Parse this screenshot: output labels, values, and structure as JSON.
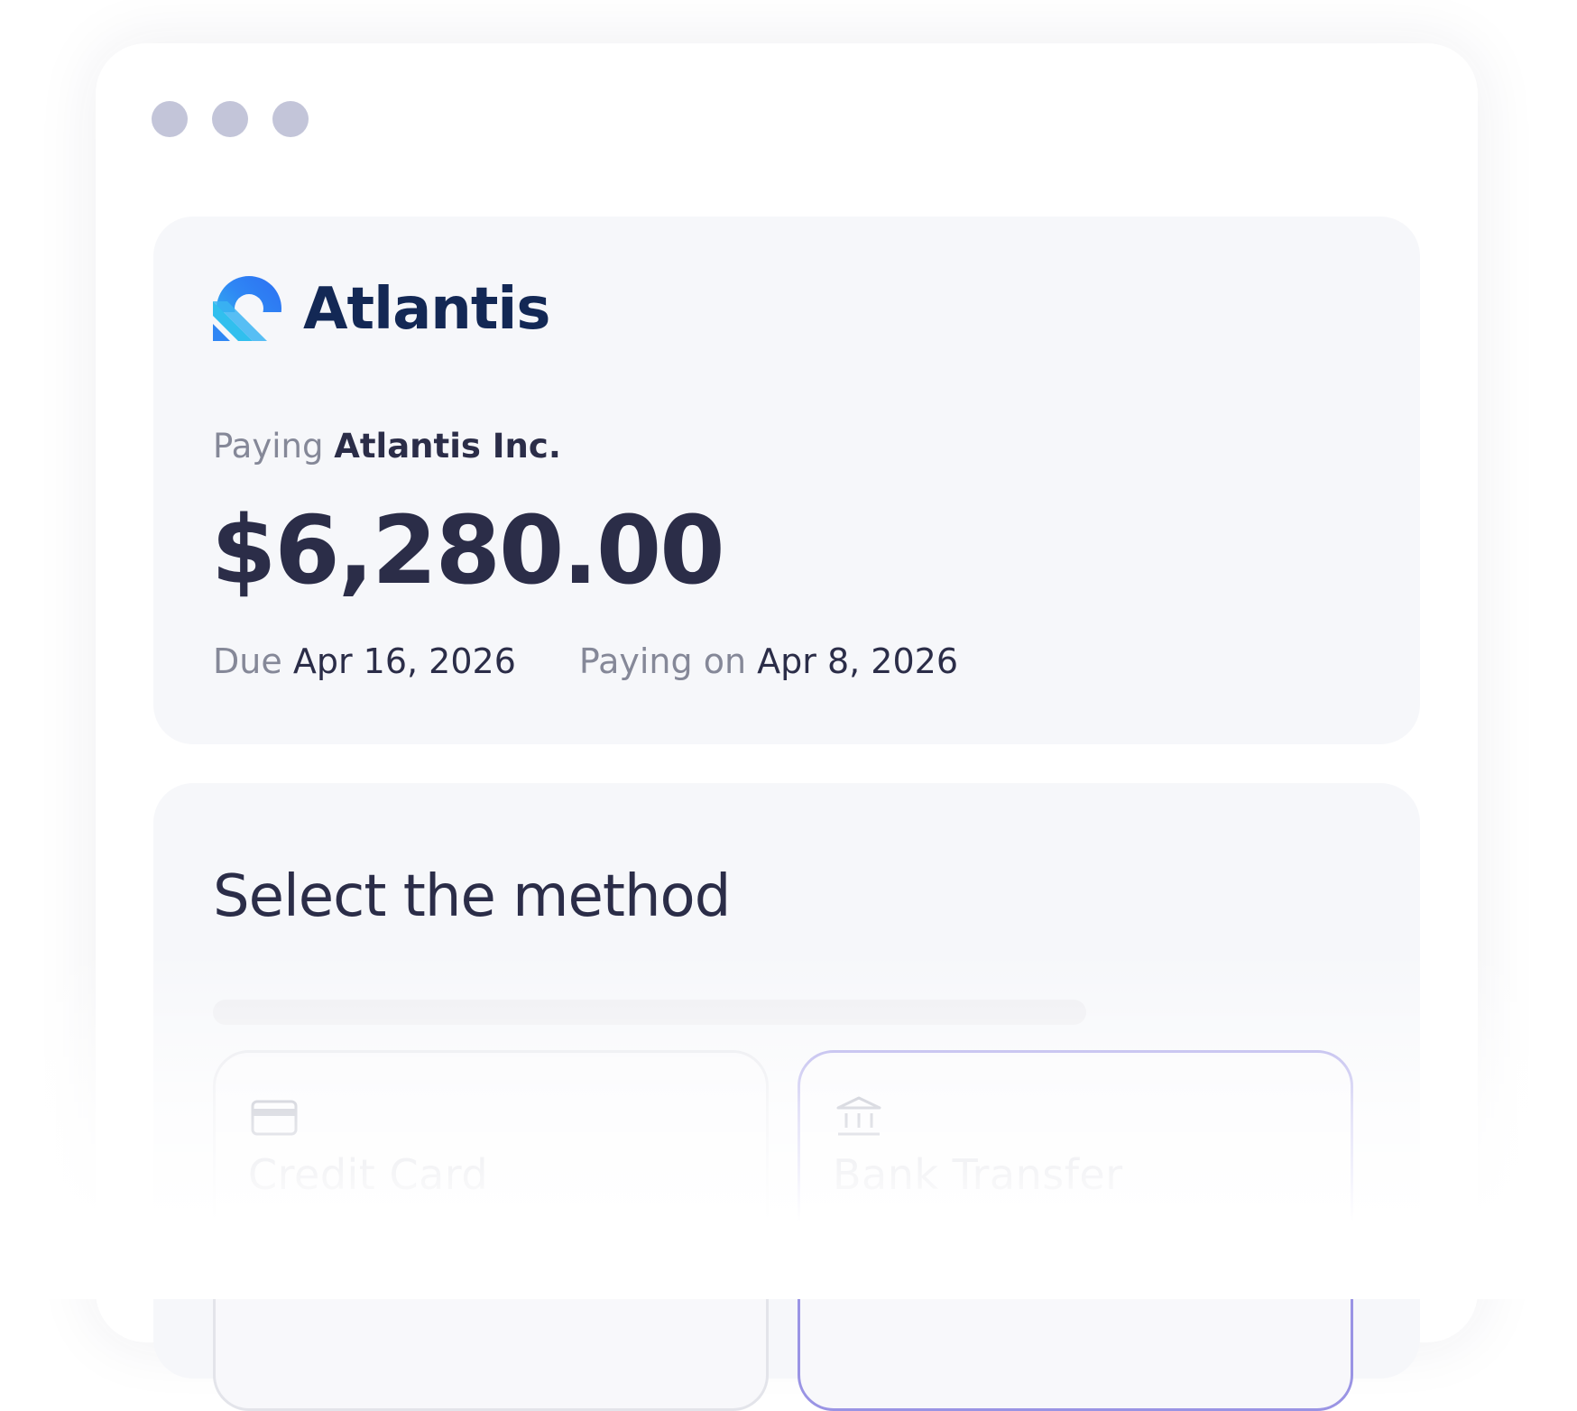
{
  "window": {
    "controls": [
      "window-dot",
      "window-dot",
      "window-dot"
    ]
  },
  "summary": {
    "brand_name": "Atlantis",
    "paying_label": "Paying",
    "payee": "Atlantis Inc.",
    "amount": "$6,280.00",
    "due_label": "Due",
    "due_date": "Apr 16, 2026",
    "paying_on_label": "Paying on",
    "paying_on_date": "Apr 8, 2026"
  },
  "method": {
    "title": "Select the method",
    "options": [
      {
        "label": "Credit Card",
        "icon": "credit-card-icon"
      },
      {
        "label": "Bank Transfer",
        "icon": "bank-icon"
      }
    ]
  },
  "colors": {
    "text_primary": "#2b2d48",
    "text_muted": "#858898",
    "brand_blue": "#2f7cf6",
    "selected_border": "#9a94e4"
  }
}
